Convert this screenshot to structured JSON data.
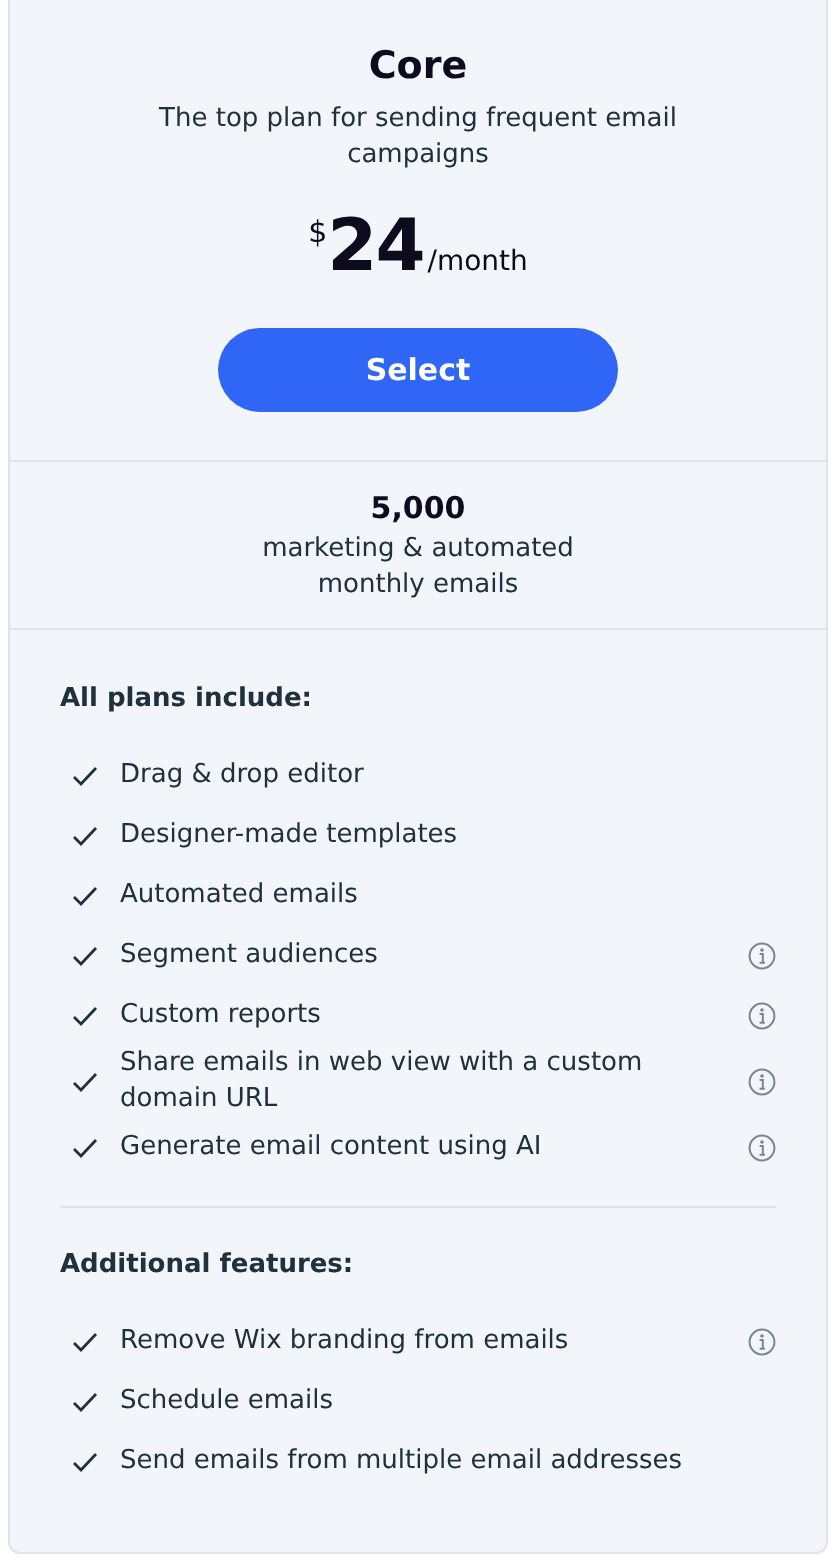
{
  "plan": {
    "name": "Core",
    "description": "The top plan for sending frequent email campaigns",
    "currency": "$",
    "price": "24",
    "period": "/month",
    "button": "Select"
  },
  "quota": {
    "amount": "5,000",
    "label": "marketing & automated monthly emails"
  },
  "sections": [
    {
      "title": "All plans include:",
      "features": [
        {
          "text": "Drag & drop editor",
          "info": false
        },
        {
          "text": "Designer-made templates",
          "info": false
        },
        {
          "text": "Automated emails",
          "info": false
        },
        {
          "text": "Segment audiences",
          "info": true
        },
        {
          "text": "Custom reports",
          "info": true
        },
        {
          "text": "Share emails in web view with a custom domain URL",
          "info": true
        },
        {
          "text": "Generate email content using AI",
          "info": true
        }
      ]
    },
    {
      "title": "Additional features:",
      "features": [
        {
          "text": "Remove Wix branding from emails",
          "info": true
        },
        {
          "text": "Schedule emails",
          "info": false
        },
        {
          "text": "Send emails from multiple email addresses",
          "info": false
        }
      ]
    }
  ]
}
